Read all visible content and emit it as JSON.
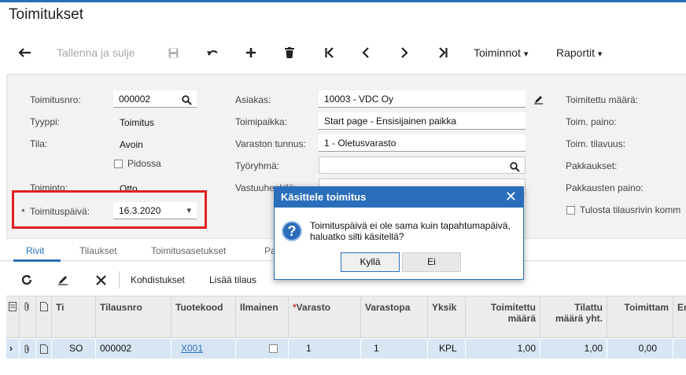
{
  "page": {
    "title": "Toimitukset"
  },
  "toolbar": {
    "back_icon": "arrow-left-icon",
    "save_close": "Tallenna ja sulje",
    "actions": "Toiminnot",
    "reports": "Raportit",
    "caret": "▾"
  },
  "form": {
    "shipment_nbr_label": "Toimitusnro:",
    "shipment_nbr": "000002",
    "type_label": "Tyyppi:",
    "type": "Toimitus",
    "status_label": "Tila:",
    "status": "Avoin",
    "hold_label": "Pidossa",
    "operation_label": "Toiminto:",
    "operation": "Otto",
    "required_mark": "*",
    "shipment_date_label": "Toimituspäivä:",
    "shipment_date": "16.3.2020",
    "customer_label": "Asiakas:",
    "customer": "10003 - VDC Oy",
    "location_label": "Toimipaikka:",
    "location": "Start page - Ensisijainen paikka",
    "warehouse_label": "Varaston tunnus:",
    "warehouse": "1 - Oletusvarasto",
    "workgroup_label": "Työryhmä:",
    "workgroup": "",
    "owner_label": "Vastuuhenkilö:",
    "shipped_qty_label": "Toimitettu määrä:",
    "weight_label": "Toim. paino:",
    "volume_label": "Toim. tilavuus:",
    "packages_label": "Pakkaukset:",
    "package_weight_label": "Pakkausten paino:",
    "print_label": "Tulosta tilausrivin komm"
  },
  "tabs": [
    "Rivit",
    "Tilaukset",
    "Toimitusasetukset",
    "Pa"
  ],
  "grid_toolbar": {
    "allocations": "Kohdistukset",
    "add_order": "Lisää tilaus"
  },
  "grid": {
    "headers": [
      "Ti",
      "Tilausnro",
      "Tuotekood",
      "Ilmainen",
      "Varasto",
      "Varastopa",
      "Yksik",
      "Toimitettu määrä",
      "Tilattu määrä yht.",
      "Toimittam",
      "Er"
    ],
    "rows": [
      {
        "type": "SO",
        "order_nbr": "000002",
        "item": "X001",
        "free": "",
        "warehouse": "1",
        "location": "1",
        "uom": "KPL",
        "shipped_qty": "1,00",
        "ordered_qty": "1,00",
        "to_ship": "0,00"
      }
    ]
  },
  "dialog": {
    "title": "Käsittele toimitus",
    "message": "Toimituspäivä ei ole sama kuin tapahtumapäivä, haluatko silti käsitellä?",
    "yes": "Kyllä",
    "no": "Ei"
  }
}
